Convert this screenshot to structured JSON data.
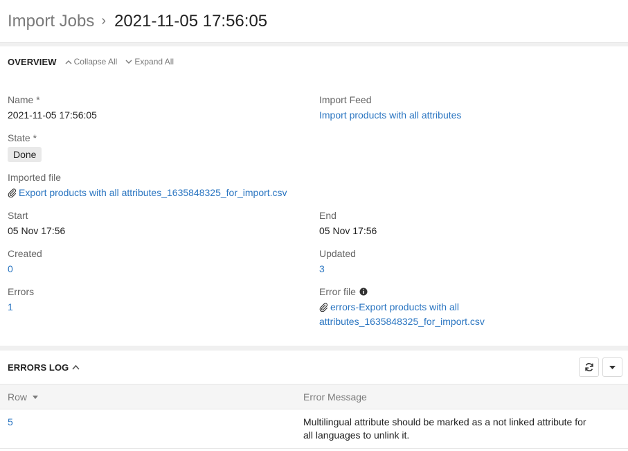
{
  "breadcrumb": {
    "root": "Import Jobs",
    "separator": "›",
    "title": "2021-11-05 17:56:05"
  },
  "overview": {
    "title": "OVERVIEW",
    "collapse_all": "Collapse All",
    "expand_all": "Expand All",
    "fields": {
      "name": {
        "label": "Name *",
        "value": "2021-11-05 17:56:05"
      },
      "import_feed": {
        "label": "Import Feed",
        "value": "Import products with all attributes"
      },
      "state": {
        "label": "State *",
        "value": "Done"
      },
      "imported_file": {
        "label": "Imported file",
        "value": "Export products with all attributes_1635848325_for_import.csv"
      },
      "start": {
        "label": "Start",
        "value": "05 Nov 17:56"
      },
      "end": {
        "label": "End",
        "value": "05 Nov 17:56"
      },
      "created": {
        "label": "Created",
        "value": "0"
      },
      "updated": {
        "label": "Updated",
        "value": "3"
      },
      "errors": {
        "label": "Errors",
        "value": "1"
      },
      "error_file": {
        "label": "Error file",
        "value_line1": "errors-Export products with all",
        "value_line2": "attributes_1635848325_for_import.csv"
      }
    }
  },
  "errors_log": {
    "title": "ERRORS LOG",
    "columns": {
      "row": "Row",
      "message": "Error Message"
    },
    "rows": [
      {
        "row": "5",
        "message_line1": "Multilingual attribute should be marked as a not linked attribute for",
        "message_line2": "all languages to unlink it."
      }
    ]
  },
  "colors": {
    "link": "#2a75c1",
    "muted": "#7a7a7a",
    "badge_bg": "#e9e9e9"
  },
  "icons": [
    "chevron-up-icon",
    "chevron-down-icon",
    "paperclip-icon",
    "info-icon",
    "refresh-icon",
    "caret-down-icon",
    "sort-caret-icon"
  ]
}
